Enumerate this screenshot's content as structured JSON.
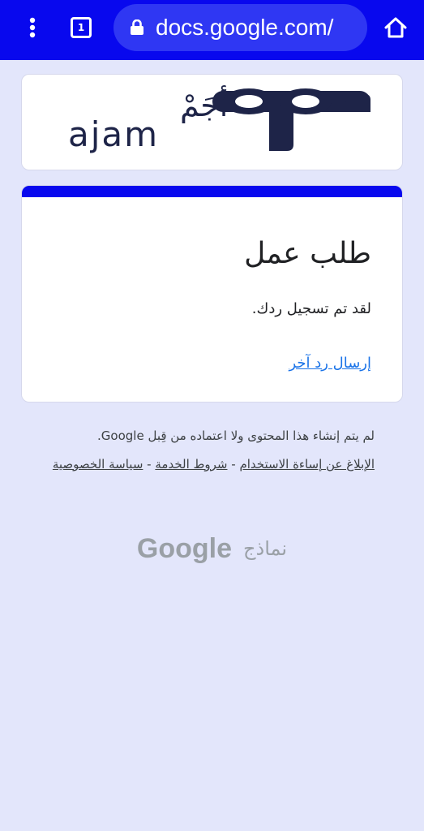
{
  "browser": {
    "url": "docs.google.com/",
    "tab_count": "1",
    "toolbar_color": "#0808ee",
    "address_bar_color": "#2f37f3",
    "icons": [
      "more-vert-icon",
      "tabs-icon",
      "lock-icon",
      "home-icon"
    ]
  },
  "logo": {
    "arabic_text": "أجَمْ",
    "latin_text": "ajam",
    "color": "#1e2448"
  },
  "form": {
    "title": "طلب عمل",
    "confirmation_message": "لقد تم تسجيل ردك.",
    "another_response_link": "إرسال رد آخر",
    "accent_color": "#0808ee",
    "link_color": "#1a73e8"
  },
  "footer": {
    "disclaimer": "لم يتم إنشاء هذا المحتوى ولا اعتماده من قِبل Google.",
    "links": {
      "report_abuse": "الإبلاغ عن إساءة الاستخدام",
      "terms": "شروط الخدمة",
      "privacy": "سياسة الخصوصية"
    },
    "separator": "-"
  },
  "branding": {
    "google": "Google",
    "forms": "نماذج"
  }
}
